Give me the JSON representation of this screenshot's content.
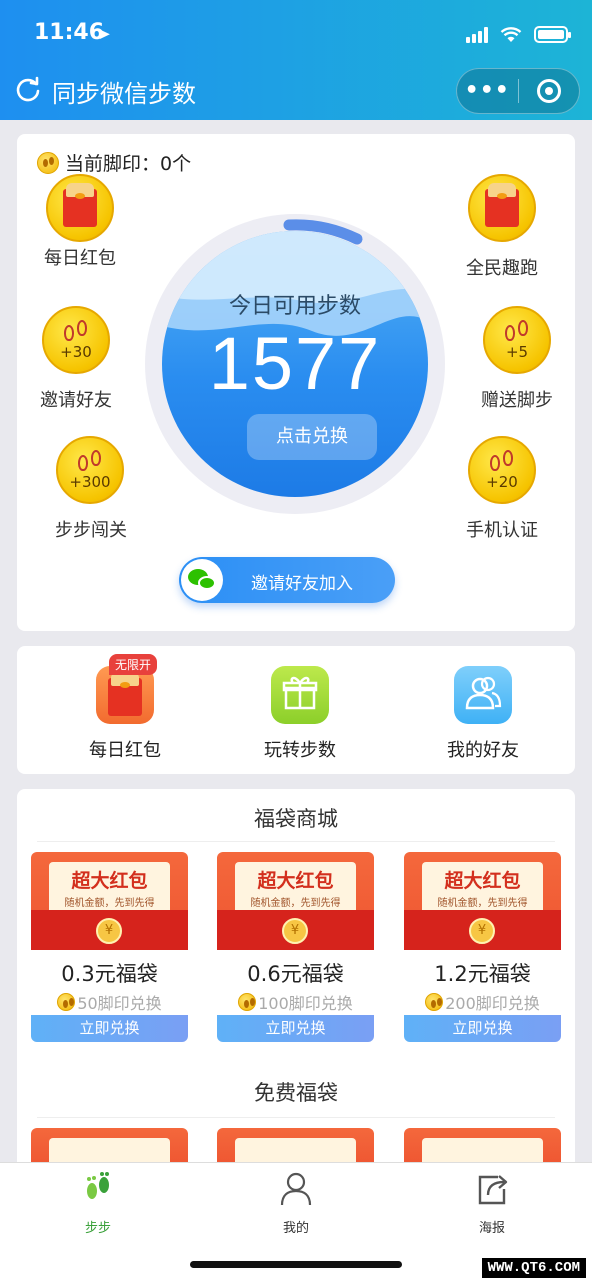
{
  "status_bar": {
    "time": "11:46"
  },
  "nav": {
    "title": "同步微信步数"
  },
  "main_card": {
    "footprint_label": "当前脚印：0个",
    "left_buttons": [
      {
        "label": "每日红包",
        "bonus": ""
      },
      {
        "label": "邀请好友",
        "bonus": "+30"
      },
      {
        "label": "步步闯关",
        "bonus": "+300"
      }
    ],
    "right_buttons": [
      {
        "label": "全民趣跑",
        "bonus": ""
      },
      {
        "label": "赠送脚步",
        "bonus": "+5"
      },
      {
        "label": "手机认证",
        "bonus": "+20"
      }
    ],
    "circle_title": "今日可用步数",
    "steps": "1577",
    "exchange_label": "点击兑换",
    "invite_label": "邀请好友加入"
  },
  "quick_nav": [
    {
      "label": "每日红包",
      "badge": "无限开",
      "icon": "red-packet-icon"
    },
    {
      "label": "玩转步数",
      "icon": "gift-icon"
    },
    {
      "label": "我的好友",
      "icon": "friends-icon"
    }
  ],
  "mall": {
    "title": "福袋商城",
    "products": [
      {
        "banner_title": "超大红包",
        "banner_sub": "随机金额，先到先得",
        "coin": "¥",
        "name": "0.3元福袋",
        "price": "50脚印兑换",
        "button": "立即兑换"
      },
      {
        "banner_title": "超大红包",
        "banner_sub": "随机金额，先到先得",
        "coin": "¥",
        "name": "0.6元福袋",
        "price": "100脚印兑换",
        "button": "立即兑换"
      },
      {
        "banner_title": "超大红包",
        "banner_sub": "随机金额，先到先得",
        "coin": "¥",
        "name": "1.2元福袋",
        "price": "200脚印兑换",
        "button": "立即兑换"
      }
    ]
  },
  "free_section": {
    "title": "免费福袋"
  },
  "tabbar": [
    {
      "label": "步步",
      "active": true,
      "icon": "footprint-icon"
    },
    {
      "label": "我的",
      "active": false,
      "icon": "person-icon"
    },
    {
      "label": "海报",
      "active": false,
      "icon": "share-icon"
    }
  ],
  "watermark": "WWW.QT6.COM",
  "colors": {
    "primary": "#1e8ff0",
    "accent_gold": "#f6c400",
    "tab_active": "#3aa13a"
  }
}
